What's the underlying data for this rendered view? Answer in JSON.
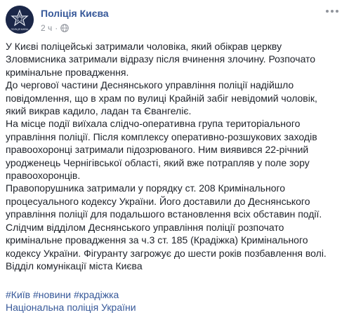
{
  "header": {
    "page_name": "Поліція Києва",
    "timestamp": "2 ч",
    "separator": "·",
    "privacy_icon": "globe-icon",
    "avatar_icon": "police-badge-icon",
    "avatar_caption": "ПОЛІЦІЯ КИЄВА",
    "more_icon": "ellipsis-icon"
  },
  "post": {
    "lines": [
      "У Києві поліцейські затримали чоловіка, який обікрав церкву",
      "Зловмисника затримали відразу після вчинення злочину. Розпочато",
      "кримінальне провадження.",
      "До чергової частини Деснянського управління поліції надійшло",
      "повідомлення, що в храм по вулиці Крайній забіг невідомий чоловік,",
      "який викрав кадило, ладан та Євангеліє.",
      "На місце події виїхала слідчо-оперативна група територіального",
      "управління поліції. Після комплексу оперативно-розшукових заходів",
      "правоохоронці затримали підозрюваного. Ним виявився 22-річний",
      "уродженець Чернігівської області, який вже потрапляв у поле зору",
      "правоохоронців.",
      "Правопорушника затримали у порядку ст. 208 Кримінального",
      "процесуального кодексу України. Його доставили до Деснянського",
      "управління поліції для подальшого встановлення всіх обставин події.",
      "Слідчим відділом Деснянського управління поліції розпочато",
      "кримінальне провадження за ч.3 ст. 185 (Крадіжка) Кримінального",
      "кодексу України. Фігуранту загрожує до шести років позбавлення волі.",
      "Відділ комунікації міста Києва"
    ],
    "hashtags": [
      "#Київ",
      "#новини",
      "#крадіжка"
    ],
    "source_link": "Національна поліція України"
  },
  "colors": {
    "link": "#365899",
    "text": "#1d2129",
    "meta": "#90949c",
    "avatar_bg": "#1b2748"
  }
}
